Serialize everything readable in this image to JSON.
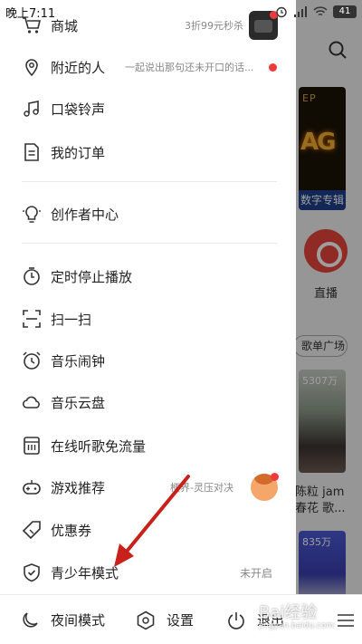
{
  "status": {
    "time": "晚上7:11",
    "battery": "41"
  },
  "drawer": {
    "shop": {
      "label": "商城",
      "promo": "3折99元秒杀"
    },
    "nearby": {
      "label": "附近的人",
      "subtitle": "一起说出那句还未开口的话..."
    },
    "ringtone": {
      "label": "口袋铃声"
    },
    "orders": {
      "label": "我的订单"
    },
    "creator": {
      "label": "创作者中心"
    },
    "sleep_timer": {
      "label": "定时停止播放"
    },
    "scan": {
      "label": "扫一扫"
    },
    "alarm": {
      "label": "音乐闹钟"
    },
    "cloud": {
      "label": "音乐云盘"
    },
    "free_data": {
      "label": "在线听歌免流量"
    },
    "games": {
      "label": "游戏推荐",
      "subtitle": "梗界-灵压对决"
    },
    "coupons": {
      "label": "优惠券"
    },
    "youth_mode": {
      "label": "青少年模式",
      "status": "未开启"
    }
  },
  "bottom_bar": {
    "night_mode": "夜间模式",
    "settings": "设置",
    "logout": "退出"
  },
  "background": {
    "album_tag": "EP",
    "album_caption": "数字专辑",
    "live_label": "直播",
    "playlist_square": "歌单广场",
    "play_count_1": "5307万",
    "song_line_1": "陈粒 jam",
    "song_line_2": "春花 歌...",
    "play_count_2": "835万"
  },
  "watermark": {
    "text": "Bai经验",
    "url": "jingyan.baidu.com"
  },
  "colors": {
    "accent": "#f03a3a",
    "arrow": "#c8211a"
  }
}
